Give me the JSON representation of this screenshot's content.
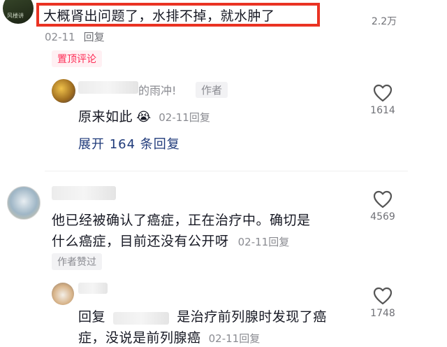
{
  "comments": {
    "top": {
      "avatar_text": "风楼讲",
      "text": "大概肾出问题了，水排不掉，就水肿了",
      "date": "02-11",
      "reply_label": "回复",
      "badge": "置顶评论",
      "likes": "2.2万"
    },
    "author_reply": {
      "name_suffix": "的雨冲!",
      "author_tag": "作者",
      "text": "原来如此",
      "emoji": "😭",
      "date": "02-11",
      "reply_label": "回复",
      "likes": "1614",
      "expand_label": "展开 164 条回复"
    },
    "second": {
      "text_line1": "他已经被确认了癌症，正在治疗中。确切是",
      "text_line2": "什么癌症，目前还没有公开呀",
      "date": "02-11",
      "reply_label": "回复",
      "badge": "作者赞过",
      "likes": "4569"
    },
    "second_reply": {
      "reply_prefix": "回复",
      "text_line1": "是治疗前列腺时发现了癌",
      "text_line2": "症，没说是前列腺癌",
      "date": "02-11",
      "reply_label": "回复",
      "likes": "1748"
    }
  },
  "icons": {
    "heart": "heart-outline-icon"
  },
  "colors": {
    "highlight": "#ea3323",
    "accent_red": "#fe2c55",
    "link_blue": "#1f3a7a"
  }
}
